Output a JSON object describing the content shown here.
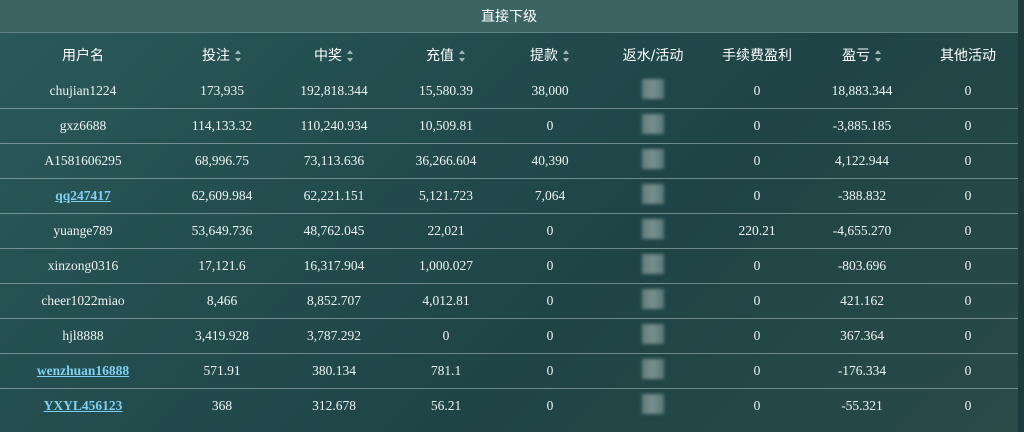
{
  "panel": {
    "title": "直接下级"
  },
  "columns": [
    {
      "label": "用户名",
      "sortable": false
    },
    {
      "label": "投注",
      "sortable": true
    },
    {
      "label": "中奖",
      "sortable": true
    },
    {
      "label": "充值",
      "sortable": true
    },
    {
      "label": "提款",
      "sortable": true
    },
    {
      "label": "返水/活动",
      "sortable": false
    },
    {
      "label": "手续费盈利",
      "sortable": false
    },
    {
      "label": "盈亏",
      "sortable": true
    },
    {
      "label": "其他活动",
      "sortable": false
    }
  ],
  "rows": [
    {
      "user": "chujian1224",
      "link": false,
      "bet": "173,935",
      "win": "192,818.344",
      "deposit": "15,580.39",
      "withdraw": "38,000",
      "fee_profit": "0",
      "pnl": "18,883.344",
      "other": "0"
    },
    {
      "user": "gxz6688",
      "link": false,
      "bet": "114,133.32",
      "win": "110,240.934",
      "deposit": "10,509.81",
      "withdraw": "0",
      "fee_profit": "0",
      "pnl": "-3,885.185",
      "other": "0"
    },
    {
      "user": "A1581606295",
      "link": false,
      "bet": "68,996.75",
      "win": "73,113.636",
      "deposit": "36,266.604",
      "withdraw": "40,390",
      "fee_profit": "0",
      "pnl": "4,122.944",
      "other": "0"
    },
    {
      "user": "qq247417",
      "link": true,
      "bet": "62,609.984",
      "win": "62,221.151",
      "deposit": "5,121.723",
      "withdraw": "7,064",
      "fee_profit": "0",
      "pnl": "-388.832",
      "other": "0"
    },
    {
      "user": "yuange789",
      "link": false,
      "bet": "53,649.736",
      "win": "48,762.045",
      "deposit": "22,021",
      "withdraw": "0",
      "fee_profit": "220.21",
      "pnl": "-4,655.270",
      "other": "0"
    },
    {
      "user": "xinzong0316",
      "link": false,
      "bet": "17,121.6",
      "win": "16,317.904",
      "deposit": "1,000.027",
      "withdraw": "0",
      "fee_profit": "0",
      "pnl": "-803.696",
      "other": "0"
    },
    {
      "user": "cheer1022miao",
      "link": false,
      "bet": "8,466",
      "win": "8,852.707",
      "deposit": "4,012.81",
      "withdraw": "0",
      "fee_profit": "0",
      "pnl": "421.162",
      "other": "0"
    },
    {
      "user": "hjl8888",
      "link": false,
      "bet": "3,419.928",
      "win": "3,787.292",
      "deposit": "0",
      "withdraw": "0",
      "fee_profit": "0",
      "pnl": "367.364",
      "other": "0"
    },
    {
      "user": "wenzhuan16888",
      "link": true,
      "bet": "571.91",
      "win": "380.134",
      "deposit": "781.1",
      "withdraw": "0",
      "fee_profit": "0",
      "pnl": "-176.334",
      "other": "0"
    },
    {
      "user": "YXYL456123",
      "link": true,
      "bet": "368",
      "win": "312.678",
      "deposit": "56.21",
      "withdraw": "0",
      "fee_profit": "0",
      "pnl": "-55.321",
      "other": "0"
    }
  ]
}
